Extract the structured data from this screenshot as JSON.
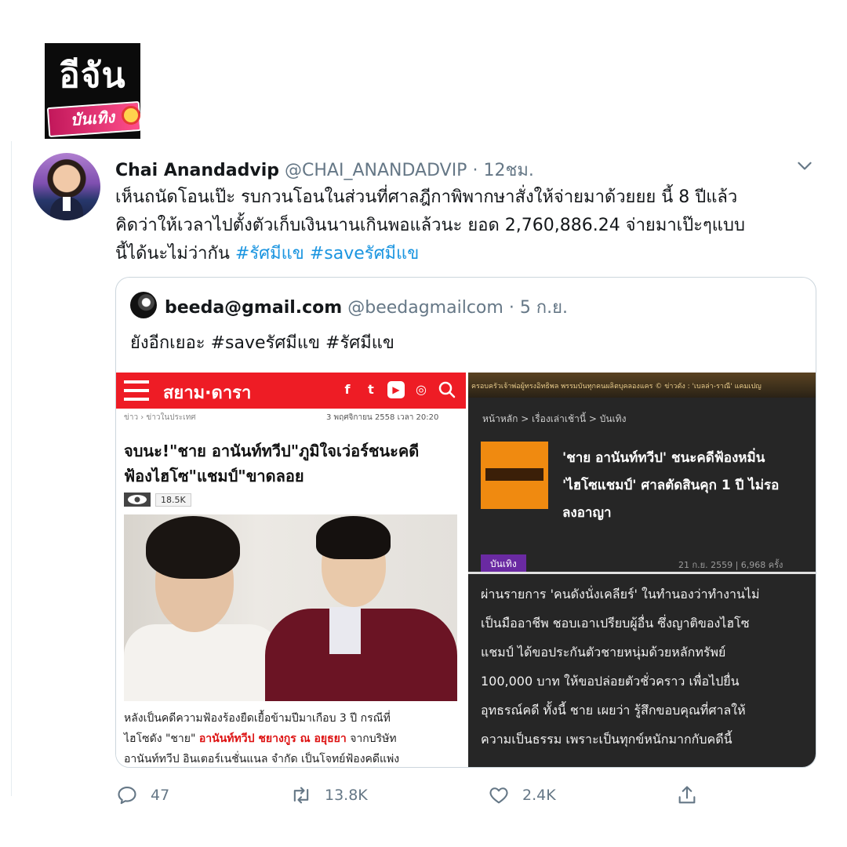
{
  "logo": {
    "main": "อีจัน",
    "sub": "บันเทิง"
  },
  "tweet": {
    "name": "Chai Anandadvip",
    "handle": "@CHAI_ANANDADVIP",
    "dot": "·",
    "time": "12ชม.",
    "lines": [
      "เห็นถนัดโอนเป๊ะ รบกวนโอนในส่วนที่ศาลฎีกาพิพากษาสั่งให้จ่ายมาด้วยยย นี้ 8 ปีแล้ว",
      "คิดว่าให้เวลาไปตั้งตัวเก็บเงินนานเกินพอแล้วนะ ยอด 2,760,886.24 จ่ายมาเป๊ะๆแบบ",
      "นี้ได้นะไม่ว่ากัน"
    ],
    "hashtags": [
      "#รัศมีแข",
      "#saveรัศมีแข"
    ]
  },
  "quote": {
    "name": "beeda@gmail.com",
    "handle": "@beedagmailcom",
    "dot": "·",
    "time": "5 ก.ย.",
    "text": "ยังอีกเยอะ #saveรัศมีแข #รัศมีแข"
  },
  "news_left": {
    "brand": "สยาม·ดารา",
    "social": [
      "f",
      "t",
      "▶",
      "◎"
    ],
    "breadcrumb": "ข่าว  ›  ข่าวในประเทศ",
    "date": "3 พฤศจิกายน 2558 เวลา 20:20",
    "title_lines": [
      "จบนะ!\"ชาย อานันท์ทวีป\"ภูมิใจเว่อร์ชนะคดี",
      "ฟ้องไฮโซ\"แชมป์\"ขาดลอย"
    ],
    "views": "18.5K",
    "body_line1": "หลังเป็นคดีความฟ้องร้องยืดเยื้อข้ามปีมาเกือบ 3 ปี กรณีที่",
    "body_line2_pre": "ไฮโซดัง \"ชาย\" ",
    "body_line2_red": "อานันท์ทวีป ชยางกูร ณ อยุธยา",
    "body_line2_post": " จากบริษัท",
    "body_line3": "อานันท์ทวีป อินเตอร์เนชั่นแนล จำกัด เป็นโจทย์ฟ้องคดีแพ่ง"
  },
  "news_right": {
    "ticker": "ครอบครัวเจ้าพ่อผู้ทรงอิทธิพล พรรมบันทุกคนผลิตบุคลองแคร   © ข่าวดัง : 'เบลล่า-ราณี' แคมเปญ",
    "breadcrumb": "หน้าหลัก  >  เรื่องเล่าเช้านี้  >  บันเทิง",
    "title_lines": [
      "'ชาย อานันท์ทวีป' ชนะคดีฟ้องหมิ่น",
      "'ไฮโซแชมป์' ศาลตัดสินคุก 1 ปี ไม่รอ",
      "ลงอาญา"
    ],
    "category": "บันเทิง",
    "meta": "21 ก.ย. 2559 | 6,968 ครั้ง",
    "body_lines": [
      "ผ่านรายการ 'คนดังนั่งเคลียร์' ในทำนองว่าทำงานไม่",
      "เป็นมืออาชีพ ชอบเอาเปรียบผู้อื่น ซึ่งญาติของไฮโซ",
      "แชมป์ ได้ขอประกันตัวชายหนุ่มด้วยหลักทรัพย์",
      "100,000 บาท ให้ขอปล่อยตัวชั่วคราว เพื่อไปยื่น",
      "อุทธรณ์คดี ทั้งนี้ ชาย เผยว่า รู้สึกขอบคุณที่ศาลให้",
      "ความเป็นธรรม เพราะเป็นทุกข์หนักมากกับคดีนี้"
    ]
  },
  "actions": {
    "replies": "47",
    "retweets": "13.8K",
    "likes": "2.4K"
  },
  "colors": {
    "link": "#1b95e0",
    "muted": "#657786",
    "siam_red": "#ee1c25",
    "dark_bg": "#262626"
  }
}
